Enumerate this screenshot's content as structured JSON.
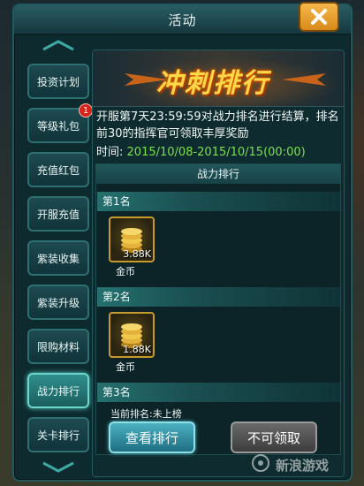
{
  "window": {
    "title": "活动"
  },
  "nav": {
    "items": [
      {
        "label": "投资计划",
        "badge": ""
      },
      {
        "label": "等级礼包",
        "badge": "1"
      },
      {
        "label": "充值红包",
        "badge": ""
      },
      {
        "label": "开服充值",
        "badge": ""
      },
      {
        "label": "紫装收集",
        "badge": ""
      },
      {
        "label": "紫装升级",
        "badge": ""
      },
      {
        "label": "限购材料",
        "badge": ""
      },
      {
        "label": "战力排行",
        "badge": "",
        "active": true
      },
      {
        "label": "关卡排行",
        "badge": ""
      }
    ]
  },
  "banner": {
    "title": "冲刺排行"
  },
  "event": {
    "description": "开服第7天23:59:59对战力排名进行结算，排名前30的指挥官可领取丰厚奖励",
    "time_label": "时间:",
    "time_value": "2015/10/08-2015/10/15(00:00)"
  },
  "ranking": {
    "header": "战力排行",
    "ranks": [
      {
        "label": "第1名",
        "reward_amount": "3.88K",
        "reward_name": "金币"
      },
      {
        "label": "第2名",
        "reward_amount": "1.88K",
        "reward_name": "金币"
      },
      {
        "label": "第3名",
        "reward_amount": "",
        "reward_name": ""
      }
    ],
    "current_rank": "当前排名:未上榜"
  },
  "buttons": {
    "view": "查看排行",
    "claim": "不可领取"
  },
  "watermark": {
    "text": "新浪游戏"
  },
  "colors": {
    "accent": "#4fd0c4",
    "time": "#7ce04a",
    "gold": "#ffd84a",
    "badge": "#d4231a"
  }
}
